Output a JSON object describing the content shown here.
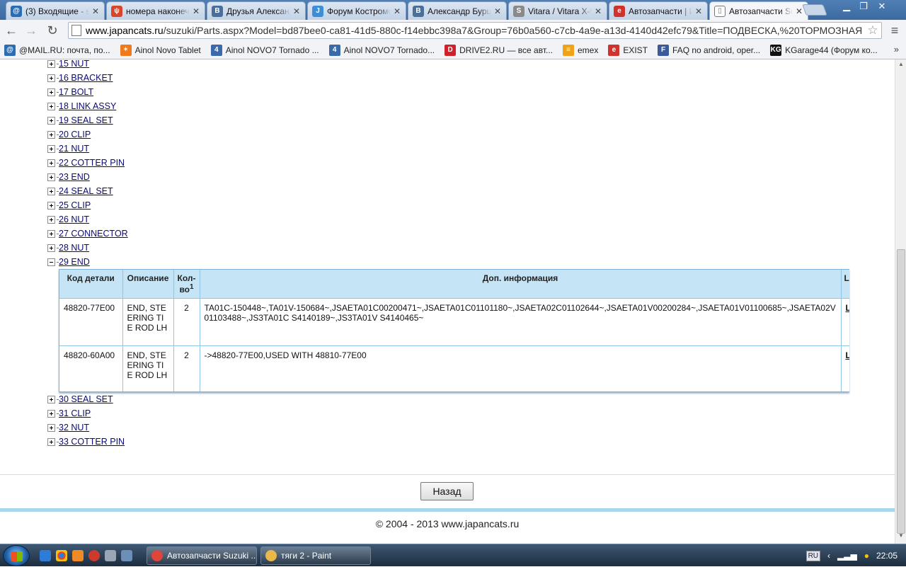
{
  "browser": {
    "tabs": [
      {
        "label": "(3) Входящие - s",
        "fav_color": "#2b6db5",
        "fav_glyph": "@"
      },
      {
        "label": "номера наконеч",
        "fav_color": "#d9452b",
        "fav_glyph": "ψ"
      },
      {
        "label": "Друзья Александ",
        "fav_color": "#4a6f9a",
        "fav_glyph": "B"
      },
      {
        "label": "Форум Костромс",
        "fav_color": "#3b8ed8",
        "fav_glyph": "J"
      },
      {
        "label": "Александр Бурце",
        "fav_color": "#4a6f9a",
        "fav_glyph": "B"
      },
      {
        "label": "Vitara / Vitara X-9",
        "fav_color": "#8a8a8a",
        "fav_glyph": "S"
      },
      {
        "label": "Автозапчасти | И",
        "fav_color": "#d0322c",
        "fav_glyph": "e"
      },
      {
        "label": "Автозапчасти Su",
        "fav_color": "#ffffff",
        "fav_glyph": "▯"
      }
    ],
    "active_tab_index": 7,
    "tab_close_glyph": "✕",
    "window": {
      "minimize": "▁",
      "restore": "❐",
      "close": "✕"
    },
    "nav": {
      "back": "←",
      "forward": "→",
      "reload": "↻",
      "menu": "≡"
    },
    "url_host": "www.japancats.ru",
    "url_path": "/suzuki/Parts.aspx?Model=bd87bee0-ca81-41d5-880c-f14ebbc398a7&Group=76b0a560-c7cb-4a9e-a13d-4140d42efc79&Title=ПОДВЕСКА,%20ТОРМОЗНАЯ",
    "star": "☆",
    "bookmarks": [
      {
        "label": "@MAIL.RU: почта, по...",
        "color": "#2b6db5",
        "glyph": "@"
      },
      {
        "label": "Ainol Novo Tablet",
        "color": "#f07a1a",
        "glyph": "✶"
      },
      {
        "label": "Ainol NOVO7 Tornado ...",
        "color": "#3a6aa8",
        "glyph": "4"
      },
      {
        "label": "Ainol NOVO7 Tornado...",
        "color": "#3a6aa8",
        "glyph": "4"
      },
      {
        "label": "DRIVE2.RU — все авт...",
        "color": "#d0202a",
        "glyph": "D"
      },
      {
        "label": "emex",
        "color": "#f0a21a",
        "glyph": "≡"
      },
      {
        "label": "EXIST",
        "color": "#d0322c",
        "glyph": "e"
      },
      {
        "label": "FAQ no android, oper...",
        "color": "#3a5a9a",
        "glyph": "F"
      },
      {
        "label": "KGarage44 (Форум ко...",
        "color": "#111111",
        "glyph": "KG"
      }
    ],
    "bookmarks_more": "»"
  },
  "tree_before": [
    "15 NUT",
    "16 BRACKET",
    "17 BOLT",
    "18 LINK ASSY",
    "19 SEAL SET",
    "20 CLIP",
    "21 NUT",
    "22 COTTER PIN",
    "23 END",
    "24 SEAL SET",
    "25 CLIP",
    "26 NUT",
    "27 CONNECTOR",
    "28 NUT"
  ],
  "tree_expanded": "29 END",
  "tree_after": [
    "30 SEAL SET",
    "31 CLIP",
    "32 NUT",
    "33 COTTER PIN"
  ],
  "parts_table": {
    "headers": {
      "code": "Код детали",
      "desc": "Описание",
      "qty": "Кол-во",
      "qty_sup": "1",
      "info": "Доп. информация",
      "extra": "L"
    },
    "rows": [
      {
        "code": "48820-77E00",
        "desc": "END, STEERING TIE ROD LH",
        "qty": "2",
        "info": "TA01C-150448~,TA01V-150684~,JSAETA01C00200471~,JSAETA01C01101180~,JSAETA02C01102644~,JSAETA01V00200284~,JSAETA01V01100685~,JSAETA02V01103488~,JS3TA01C S4140189~,JS3TA01V S4140465~",
        "link": "L"
      },
      {
        "code": "48820-60A00",
        "desc": "END, STEERING TIE ROD LH",
        "qty": "2",
        "info": "->48820-77E00,USED WITH 48810-77E00",
        "link": "L"
      }
    ]
  },
  "back_button": "Назад",
  "copyright": "© 2004 - 2013 www.japancats.ru",
  "taskbar": {
    "items": [
      {
        "label": "Автозапчасти Suzuki ...",
        "color": "#e0443a"
      },
      {
        "label": "тяги 2 - Paint",
        "color": "#e8b84a"
      }
    ],
    "lang": "RU",
    "clock": "22:05"
  }
}
